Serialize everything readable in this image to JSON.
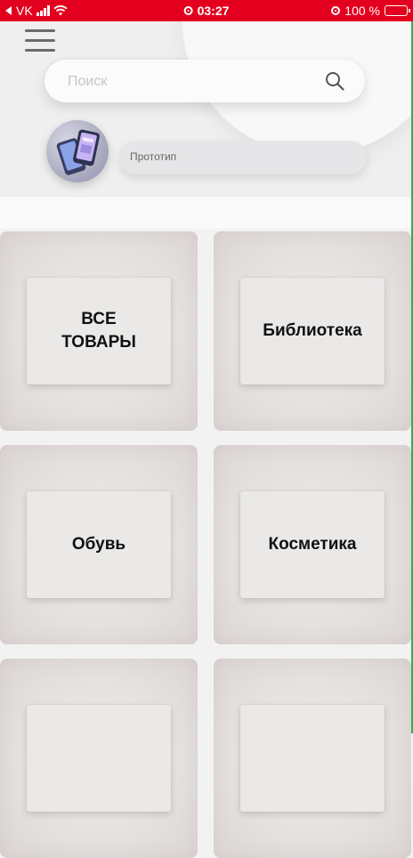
{
  "status_bar": {
    "carrier": "VK",
    "time": "03:27",
    "battery": "100 %",
    "icons": [
      "back-arrow-icon",
      "signal-icon",
      "wifi-icon",
      "alarm-icon",
      "location-icon",
      "battery-icon"
    ],
    "color": "#e3001e"
  },
  "header": {
    "menu_icon": "hamburger-menu-icon",
    "search": {
      "placeholder": "Поиск",
      "value": "",
      "icon": "search-icon"
    }
  },
  "profile": {
    "avatar_icon": "phone-prototype-image",
    "label": "Прототип"
  },
  "categories": [
    {
      "label": "ВСЕ\nТОВАРЫ"
    },
    {
      "label": "Библиотека"
    },
    {
      "label": "Обувь"
    },
    {
      "label": "Косметика"
    },
    {
      "label": ""
    },
    {
      "label": ""
    }
  ],
  "colors": {
    "accent": "#e3001e",
    "tile_bg": "#e7e5e3",
    "text": "#111111"
  }
}
